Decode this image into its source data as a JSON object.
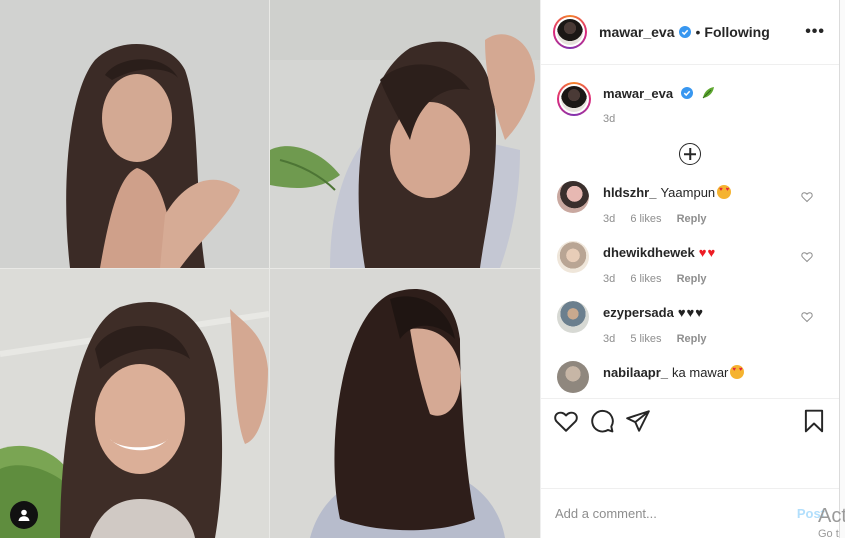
{
  "post": {
    "username": "mawar_eva",
    "follow_status": "Following",
    "separator": "•",
    "more_label": "•••",
    "caption_age": "3d"
  },
  "comments": [
    {
      "username": "hldszhr_",
      "text": "Yaampun",
      "emoji": "heart-eyes-emoji",
      "age": "3d",
      "likes": "6 likes",
      "reply": "Reply"
    },
    {
      "username": "dhewikdhewek",
      "text": "",
      "emoji_text": "♥♥",
      "age": "3d",
      "likes": "6 likes",
      "reply": "Reply"
    },
    {
      "username": "ezypersada",
      "text": "",
      "emoji_text": "♥♥♥",
      "age": "3d",
      "likes": "5 likes",
      "reply": "Reply"
    },
    {
      "username": "nabilaapr_",
      "text": "ka mawar",
      "emoji": "heart-eyes-emoji"
    }
  ],
  "add_comment": {
    "placeholder": "Add a comment...",
    "post_label": "Post"
  },
  "overlay": {
    "activate_text": "Act",
    "activate_sub": "Go t"
  },
  "colors": {
    "accent": "#0095f6",
    "post_disabled": "#b2dffc",
    "verified": "#3897f0"
  }
}
